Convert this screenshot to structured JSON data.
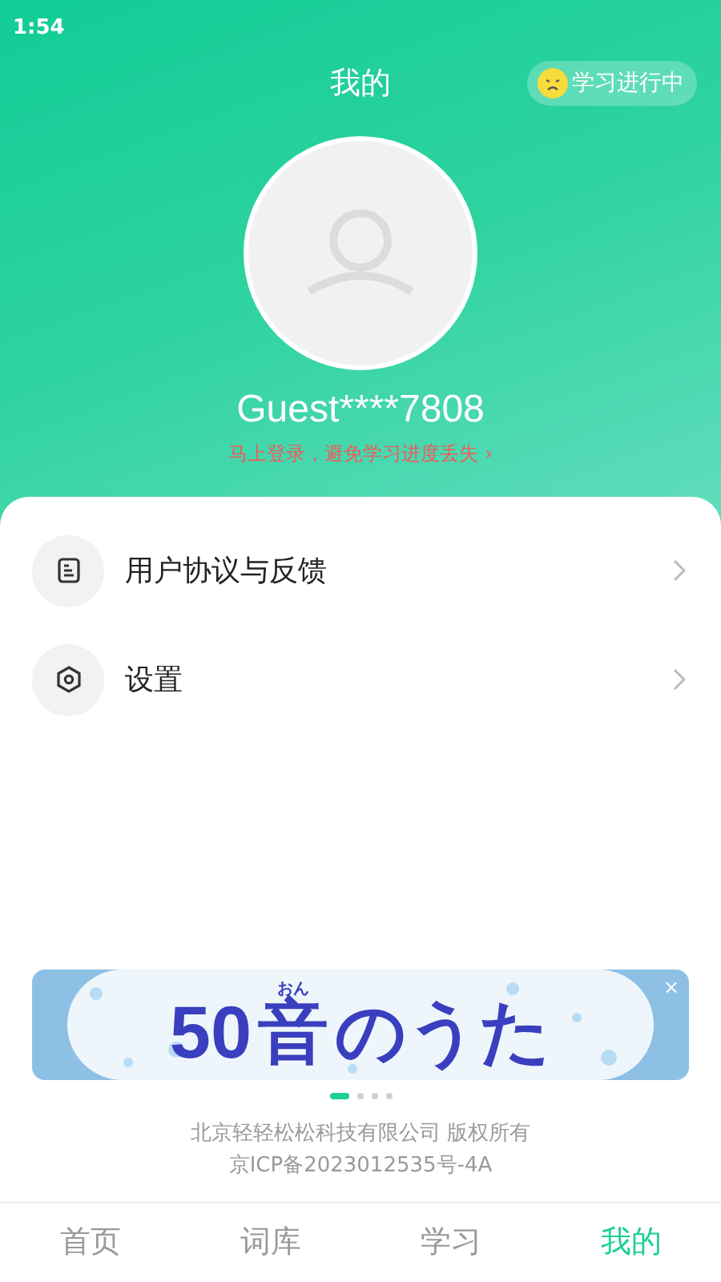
{
  "status_bar": {
    "time": "1:54"
  },
  "header": {
    "title": "我的",
    "badge": "学习进行中"
  },
  "profile": {
    "username": "Guest****7808",
    "login_prompt": "马上登录，避免学习进度丢失",
    "prompt_arrow": "›"
  },
  "menu": [
    {
      "kind": "document",
      "label": "用户协议与反馈"
    },
    {
      "kind": "settings",
      "label": "设置"
    }
  ],
  "banner": {
    "ruby": "おん",
    "title_before": "50",
    "title_kanji": "音",
    "title_after": "のうた",
    "close": "×",
    "dots": [
      {
        "selected": true
      },
      {
        "selected": false
      },
      {
        "selected": false
      },
      {
        "selected": false
      }
    ]
  },
  "footer": {
    "lines": [
      "北京轻轻松松科技有限公司 版权所有",
      "京ICP备2023012535号-4A"
    ]
  },
  "tabs": [
    {
      "label": "首页",
      "selected": false
    },
    {
      "label": "词库",
      "selected": false
    },
    {
      "label": "学习",
      "selected": false
    },
    {
      "label": "我的",
      "selected": true
    }
  ]
}
